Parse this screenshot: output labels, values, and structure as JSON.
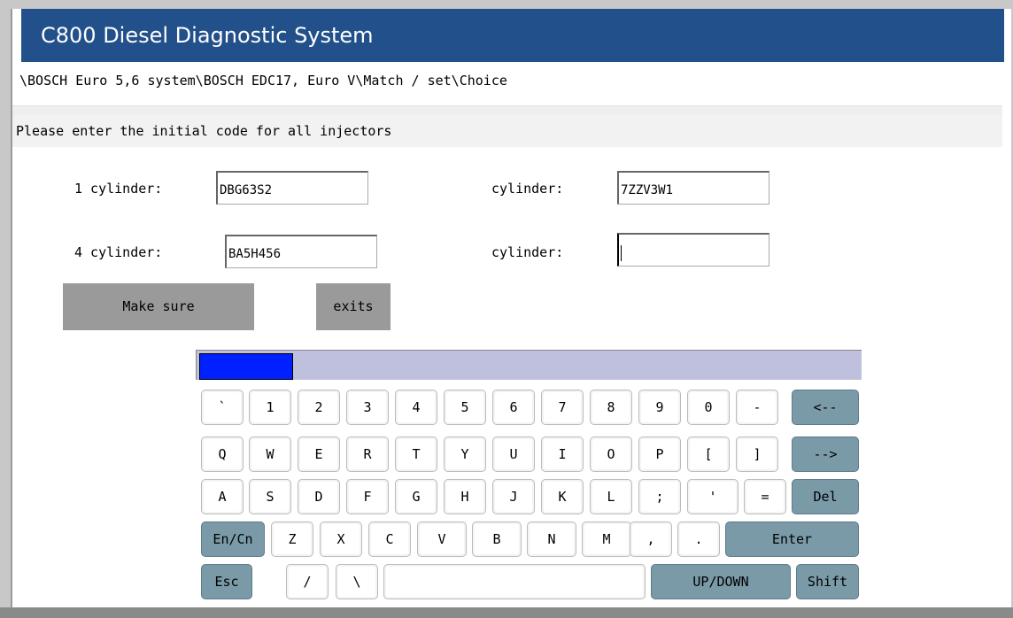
{
  "app": {
    "title": "C800 Diesel Diagnostic System"
  },
  "breadcrumb": "\\BOSCH Euro 5,6 system\\BOSCH EDC17, Euro V\\Match / set\\Choice",
  "instruction": "Please enter the initial code for all injectors",
  "fields": [
    {
      "label": "1 cylinder:",
      "value": "DBG63S2"
    },
    {
      "label": "cylinder:",
      "value": "7ZZV3W1"
    },
    {
      "label": "4 cylinder:",
      "value": "BA5H456"
    },
    {
      "label": "cylinder:",
      "value": ""
    }
  ],
  "buttons": {
    "confirm": "Make sure",
    "exit": "exits"
  },
  "keyboard": {
    "row1": [
      "`",
      "1",
      "2",
      "3",
      "4",
      "5",
      "6",
      "7",
      "8",
      "9",
      "0",
      "-",
      "<--"
    ],
    "row2": [
      "Q",
      "W",
      "E",
      "R",
      "T",
      "Y",
      "U",
      "I",
      "O",
      "P",
      "[",
      "]",
      "-->"
    ],
    "row3": [
      "A",
      "S",
      "D",
      "F",
      "G",
      "H",
      "J",
      "K",
      "L",
      ";",
      "'",
      "=",
      "Del"
    ],
    "row4": [
      "En/Cn",
      "Z",
      "X",
      "C",
      "V",
      "B",
      "N",
      "M",
      ",",
      ".",
      "Enter"
    ],
    "row5": [
      "Esc",
      "/",
      "\\",
      "",
      "UP/DOWN",
      "Shift"
    ]
  },
  "colors": {
    "title_bar": "#22508a",
    "func_key": "#7a9aa8",
    "indicator": "#0020ff",
    "kbd_header": "#bfc0dd"
  }
}
